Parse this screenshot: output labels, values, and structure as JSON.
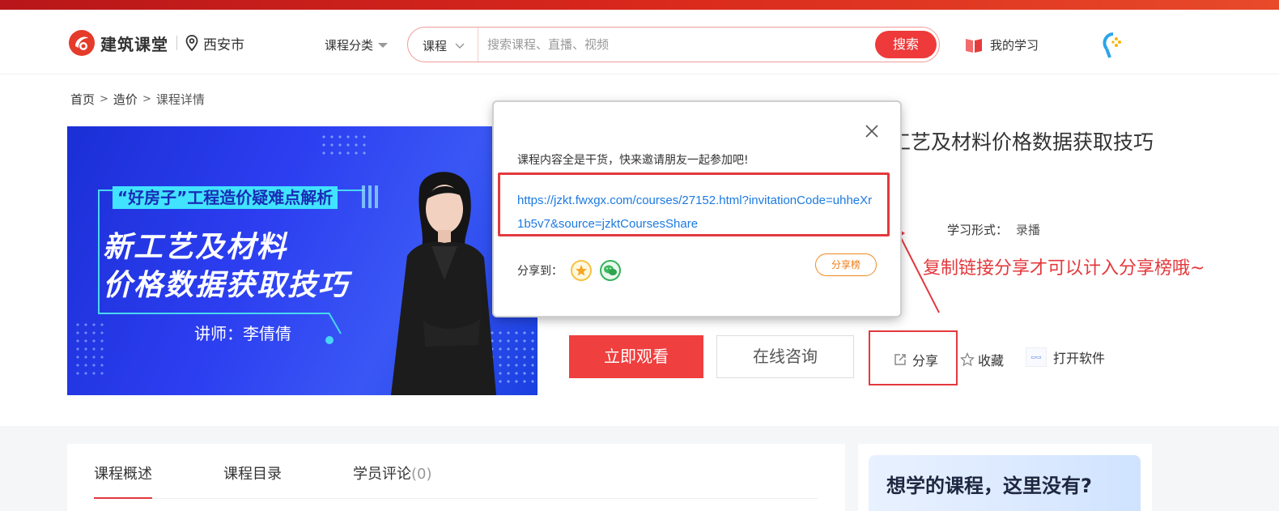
{
  "header": {
    "logo_text": "建筑课堂",
    "city": "西安市",
    "category_label": "课程分类",
    "search": {
      "scope": "课程",
      "placeholder": "搜索课程、直播、视频",
      "button": "搜索"
    },
    "my_study": "我的学习"
  },
  "breadcrumb": {
    "home": "首页",
    "sep": ">",
    "category": "造价",
    "current": "课程详情"
  },
  "banner": {
    "subtitle": "“好房子”工程造价疑难点解析",
    "title_line1": "新工艺及材料",
    "title_line2": "价格数据获取技巧",
    "lecturer": "讲师：李倩倩"
  },
  "course": {
    "title_visible": "工艺及材料价格数据获取技巧",
    "learn_form_label": "学习形式：",
    "learn_form_value": "录播"
  },
  "actions": {
    "watch": "立即观看",
    "consult": "在线咨询",
    "share": "分享",
    "favorite": "收藏",
    "open_software": "打开软件"
  },
  "annotation": "复制链接分享才可以计入分享榜哦~",
  "share_modal": {
    "invite_text": "课程内容全是干货，快来邀请朋友一起参加吧!",
    "link": "https://jzkt.fwxgx.com/courses/27152.html?invitationCode=uhheXr1b5v7&source=jzktCoursesShare",
    "share_to_label": "分享到：",
    "rank_button": "分享榜"
  },
  "tabs": [
    {
      "label": "课程概述"
    },
    {
      "label": "课程目录"
    },
    {
      "label": "学员评论",
      "count": "(0)"
    }
  ],
  "side_card": {
    "title": "想学的课程，这里没有?"
  },
  "colors": {
    "brand_red": "#ee3a3a",
    "link_blue": "#1c7ae0",
    "rank_orange": "#f07a12",
    "banner_blue": "#2c3ef0"
  }
}
